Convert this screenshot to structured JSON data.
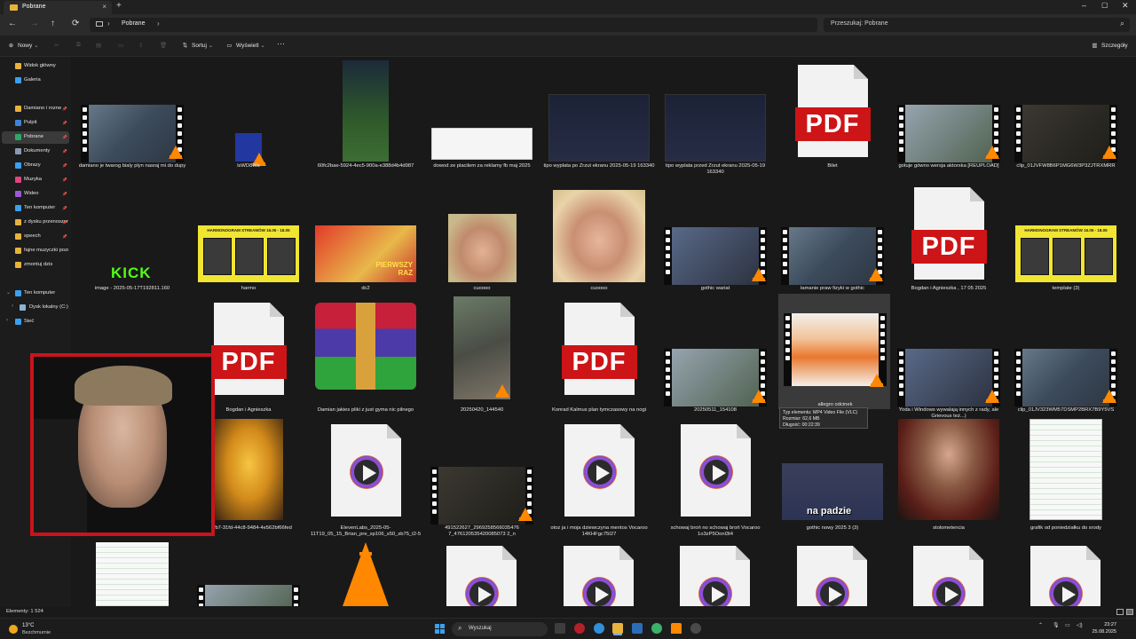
{
  "window": {
    "tab_title": "Pobrane",
    "new_tab": "+",
    "controls": {
      "minimize": "–",
      "maximize": "▢",
      "close": "✕"
    }
  },
  "nav": {
    "back": "←",
    "forward": "→",
    "up": "↑",
    "refresh": "⟳",
    "breadcrumb": "Pobrane",
    "breadcrumb_chevron": "›",
    "search_placeholder": "Przeszukaj: Pobrane",
    "search_icon": "search-icon"
  },
  "command_bar": {
    "new_label": "Nowy",
    "sort_label": "Sortuj",
    "view_label": "Wyświetl",
    "more_label": "···",
    "details_label": "Szczegóły"
  },
  "sidebar": {
    "items": [
      {
        "label": "Widok główny",
        "icon": "home-icon",
        "color": "#e8b33c",
        "pinned": false
      },
      {
        "label": "Galeria",
        "icon": "gallery-icon",
        "color": "#3aa0f0",
        "pinned": false
      },
      {
        "label": "Damiano i rozne",
        "icon": "folder-icon",
        "color": "#e8b33c",
        "pinned": true
      },
      {
        "label": "Pulpit",
        "icon": "desktop-icon",
        "color": "#3a86d6",
        "pinned": true
      },
      {
        "label": "Pobrane",
        "icon": "download-icon",
        "color": "#2fa866",
        "pinned": true,
        "selected": true
      },
      {
        "label": "Dokumenty",
        "icon": "documents-icon",
        "color": "#8a9bb0",
        "pinned": true
      },
      {
        "label": "Obrazy",
        "icon": "pictures-icon",
        "color": "#3aa0f0",
        "pinned": true
      },
      {
        "label": "Muzyka",
        "icon": "music-icon",
        "color": "#e0457b",
        "pinned": true
      },
      {
        "label": "Wideo",
        "icon": "video-icon",
        "color": "#9b59d6",
        "pinned": true
      },
      {
        "label": "Ten komputer",
        "icon": "computer-icon",
        "color": "#3aa0f0",
        "pinned": true
      },
      {
        "label": "z dysku przenoszone",
        "icon": "folder-icon",
        "color": "#e8b33c",
        "pinned": true
      },
      {
        "label": "speech",
        "icon": "folder-icon",
        "color": "#e8b33c",
        "pinned": true
      },
      {
        "label": "fajne muzyczki pozdro",
        "icon": "folder-icon",
        "color": "#e8b33c",
        "pinned": false
      },
      {
        "label": "zmontuj dzis",
        "icon": "folder-icon",
        "color": "#e8b33c",
        "pinned": false
      },
      {
        "label": "Ten komputer",
        "icon": "computer-icon",
        "color": "#3aa0f0",
        "expand": "⌄"
      },
      {
        "label": "Dysk lokalny (C:)",
        "icon": "drive-icon",
        "color": "#8ab4d6",
        "expand": "›"
      },
      {
        "label": "Sieć",
        "icon": "network-icon",
        "color": "#3aa0f0",
        "expand": "›"
      }
    ]
  },
  "files": [
    {
      "name": "damiano je twarog bialy plyn nasraj mi do dupy",
      "type": "video"
    },
    {
      "name": "lsWD8Wa",
      "type": "video-small"
    },
    {
      "name": "60fc2bae-5924-4ec5-900a-e388d4b4d987",
      "type": "image-tall"
    },
    {
      "name": "dowod ze placilem za reklamy fb maj 2025",
      "type": "image-doc"
    },
    {
      "name": "tipo wyplata po Zrzut ekranu 2025-05-19 163340",
      "type": "image-dark"
    },
    {
      "name": "tipo wyplata przed Zrzut ekranu 2025-05-19 163340",
      "type": "image-dark"
    },
    {
      "name": "Bilet",
      "type": "pdf"
    },
    {
      "name": "gotuje gówno wersja aktorska [REUPLOAD]",
      "type": "video"
    },
    {
      "name": "clip_01JVFW8B6P1MG6W3P3ZJTRXMRR",
      "type": "video"
    },
    {
      "name": "image - 2025-05-17T192811.160",
      "type": "image-kick",
      "overlay": "KICK"
    },
    {
      "name": "harmo",
      "type": "image-yellow",
      "overlay": "HARMONOGRAM STREAMÓW 16.05 - 18.05"
    },
    {
      "name": "dc2",
      "type": "image-red",
      "overlay": "PIERWSZY RAZ"
    },
    {
      "name": "cuoooo",
      "type": "image-face"
    },
    {
      "name": "cuoooo",
      "type": "image-face"
    },
    {
      "name": "gothic wariat",
      "type": "video"
    },
    {
      "name": "łamanie praw fizyki w gothic",
      "type": "video"
    },
    {
      "name": "Bogdan i Agnieszka , 17 05 2025",
      "type": "pdf"
    },
    {
      "name": "template (3)",
      "type": "image-yellow",
      "overlay": "HARMONOGRAM STREAMÓW 16.05 - 18.05"
    },
    {
      "name": "Bogdan i Agnieszka",
      "type": "pdf"
    },
    {
      "name": "Damian jakies pliki z just gyma nic pilnego",
      "type": "winrar"
    },
    {
      "name": "20250420_144540",
      "type": "video-tall"
    },
    {
      "name": "Konrad Kalmus plan tymczasowy na nogi",
      "type": "pdf"
    },
    {
      "name": "20250511_154108",
      "type": "video"
    },
    {
      "name": "allegro odcinek",
      "type": "video-selected"
    },
    {
      "name": "Yoda i Windows wywalają innych z rady, ale Grievous też...)",
      "type": "video"
    },
    {
      "name": "clip_01JV323WM57DSMP2BRX7B9Y5VS",
      "type": "video"
    },
    {
      "name": "e80fb7-31fd-44c8-9484-4e562bf66fed",
      "type": "image-gold"
    },
    {
      "name": "ElevenLabs_2025-05-11T19_05_15_Brian_pre_sp106_s50_sb75_t2-5",
      "type": "audio"
    },
    {
      "name": "491522627_2969258566035476 7_476120535420085073 2_n",
      "type": "video"
    },
    {
      "name": "otoz ja i moja dziewczyna mentos Vocaroo 14KHFgc75I27",
      "type": "audio"
    },
    {
      "name": "schowaj broń no schowaj broń Vocaroo 1o3zP5Oonl3t4",
      "type": "audio"
    },
    {
      "name": "gothic nowy 2025 3 (3)",
      "type": "image-gothic",
      "overlay": "na padzie"
    },
    {
      "name": "stolometencia",
      "type": "image-portrait"
    },
    {
      "name": "grafik od poniedziałku do srody",
      "type": "image-sheet"
    }
  ],
  "tooltip": {
    "line1": "Typ elementu: MP4 Video File (VLC)",
    "line2": "Rozmiar: 62,6 MB",
    "line3": "Długość: 00:22:39"
  },
  "status": {
    "count": "Elementy: 1 524"
  },
  "taskbar": {
    "weather_temp": "13°C",
    "weather_desc": "Bezchmurnie",
    "search_placeholder": "Wyszukaj",
    "time": "23:27",
    "date": "25.08.2025"
  }
}
